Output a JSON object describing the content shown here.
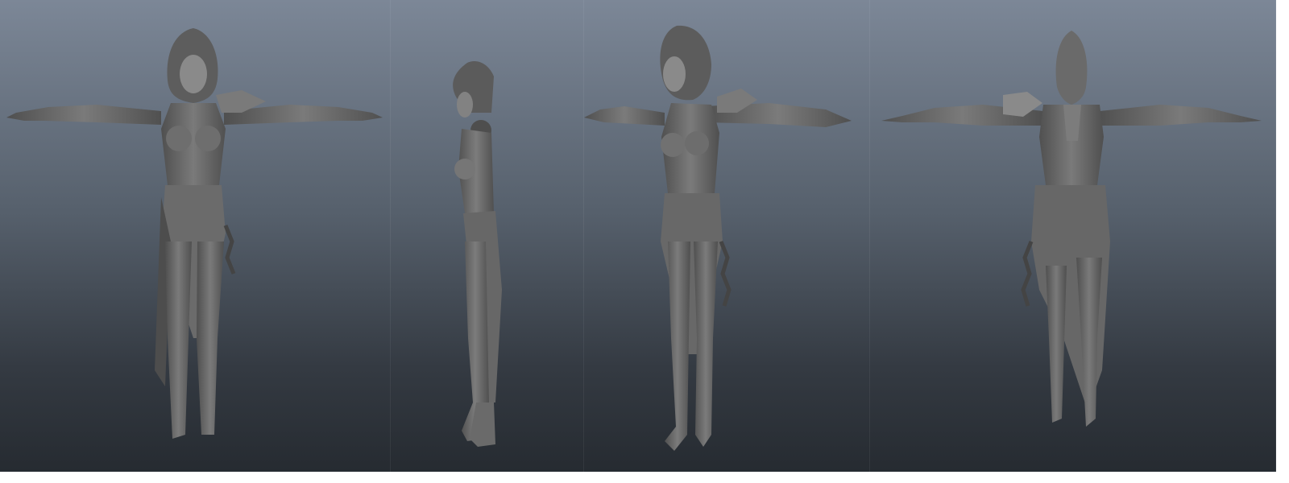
{
  "panels": [
    {
      "view": "front"
    },
    {
      "view": "side"
    },
    {
      "view": "three-quarter"
    },
    {
      "view": "back"
    }
  ],
  "colors": {
    "model": "#6a6a6a",
    "model_light": "#858585",
    "model_dark": "#4a4a4a",
    "background_top": "#7c8797",
    "background_bottom": "#262b31"
  }
}
